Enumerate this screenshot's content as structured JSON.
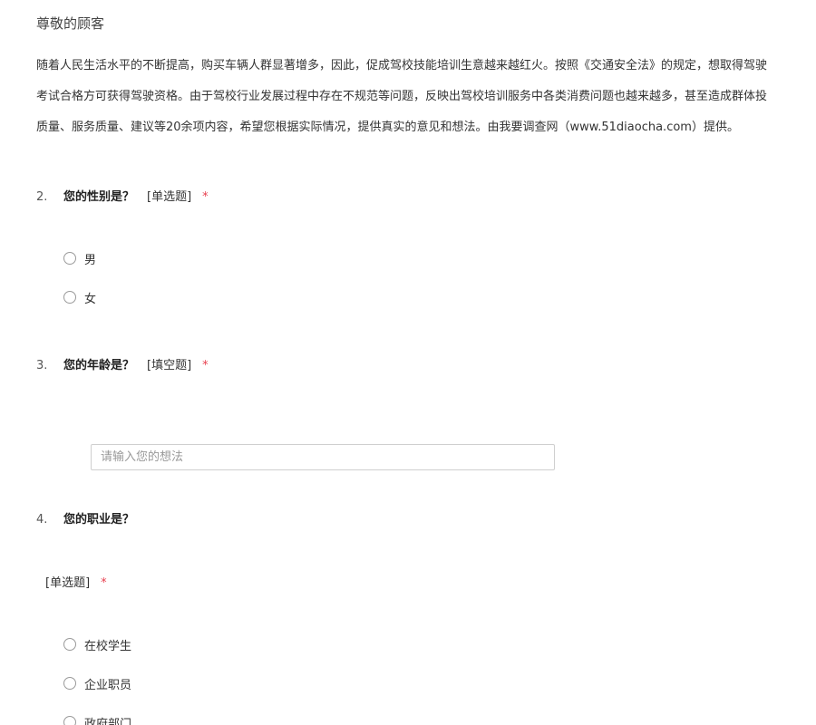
{
  "header": {
    "greeting": "尊敬的顾客"
  },
  "intro": {
    "line1": "随着人民生活水平的不断提高，购买车辆人群显著增多，因此，促成驾校技能培训生意越来越红火。按照《交通安全法》的规定，想取得驾驶",
    "line2": "考试合格方可获得驾驶资格。由于驾校行业发展过程中存在不规范等问题，反映出驾校培训服务中各类消费问题也越来越多，甚至造成群体投",
    "line3": "质量、服务质量、建议等20余项内容，希望您根据实际情况，提供真实的意见和想法。由我要调查网（www.51diaocha.com）提供。"
  },
  "questions": {
    "q2": {
      "number": "2.",
      "text": "您的性别是？",
      "type": "[单选题]",
      "required": "*",
      "options": [
        "男",
        "女"
      ]
    },
    "q3": {
      "number": "3.",
      "text": "您的年龄是？",
      "type": "[填空题]",
      "required": "*",
      "placeholder": "请输入您的想法",
      "value": ""
    },
    "q4": {
      "number": "4.",
      "text": "您的职业是？",
      "type": "[单选题]",
      "required": "*",
      "options": [
        "在校学生",
        "企业职员",
        "政府部门"
      ]
    }
  },
  "colors": {
    "required_star": "#e8404f",
    "radio_border": "#9a9a9a",
    "input_border": "#cfcfcf"
  }
}
